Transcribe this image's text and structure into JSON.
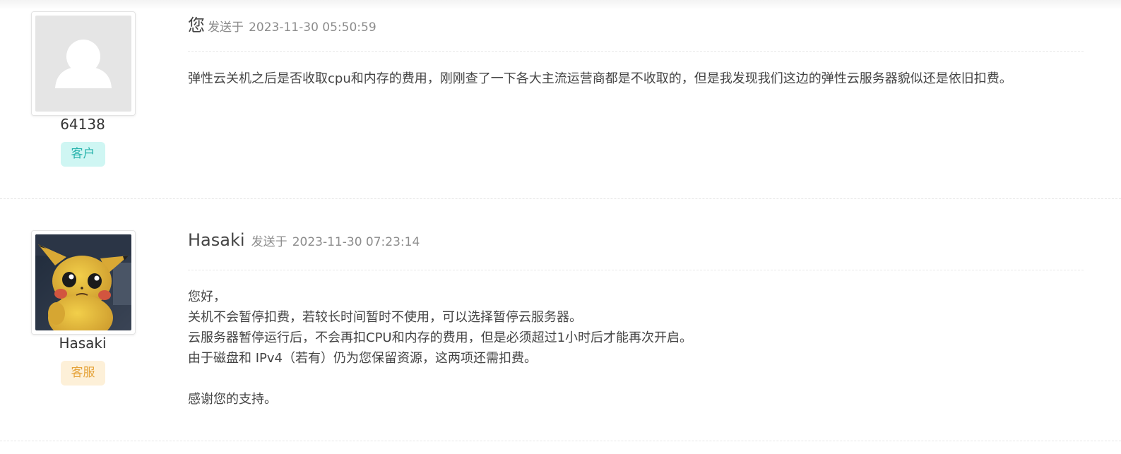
{
  "messages": [
    {
      "author": "您",
      "sent_prefix": "发送于",
      "timestamp": "2023-11-30 05:50:59",
      "username": "64138",
      "role": "客户",
      "avatar_icon": "default-user-icon",
      "body": [
        "弹性云关机之后是否收取cpu和内存的费用，刚刚查了一下各大主流运营商都是不收取的，但是我发现我们这边的弹性云服务器貌似还是依旧扣费。"
      ]
    },
    {
      "author": "Hasaki",
      "sent_prefix": "发送于",
      "timestamp": "2023-11-30 07:23:14",
      "username": "Hasaki",
      "role": "客服",
      "avatar_icon": "pikachu-avatar-image",
      "body": [
        "您好，",
        "关机不会暂停扣费，若较长时间暂时不使用，可以选择暂停云服务器。",
        "云服务器暂停运行后，不会再扣CPU和内存的费用，但是必须超过1小时后才能再次开启。",
        "由于磁盘和 IPv4（若有）仍为您保留资源，这两项还需扣费。",
        "",
        "感谢您的支持。"
      ]
    }
  ]
}
